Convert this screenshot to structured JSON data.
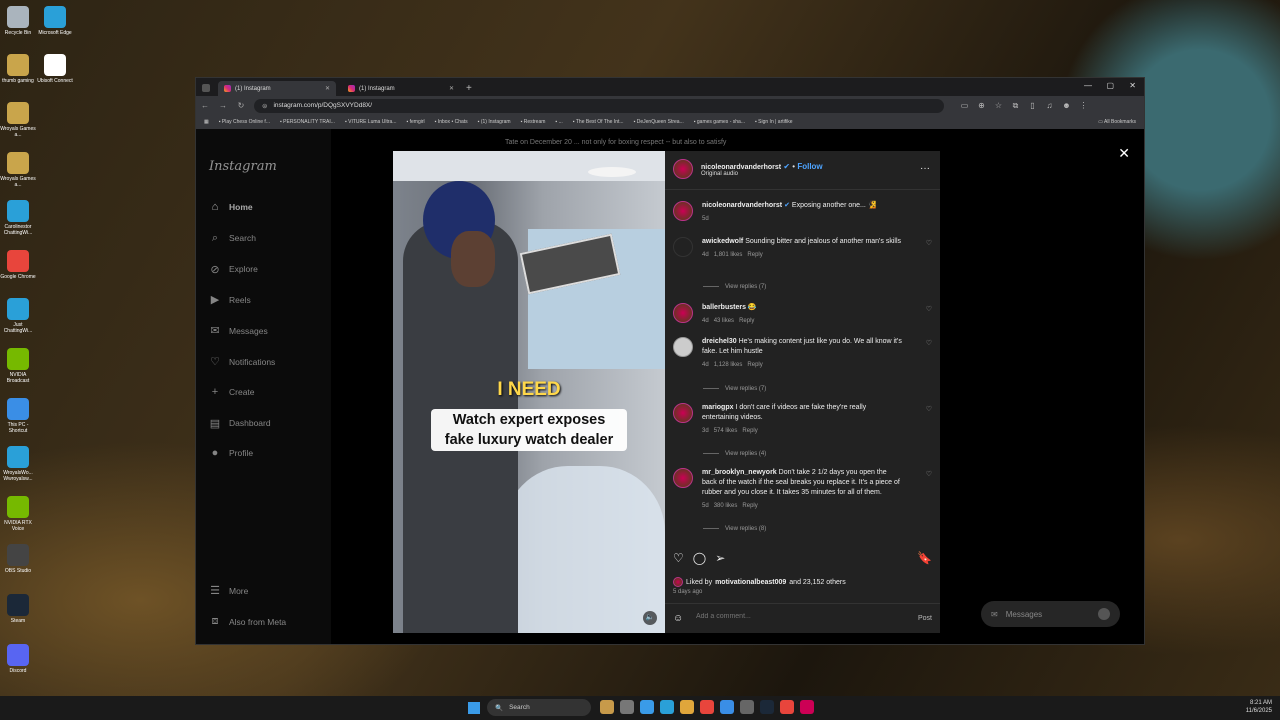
{
  "desktop": {
    "icons": [
      {
        "label": "Recycle Bin",
        "icon": "recycle-bin-icon",
        "color": "#aab4bd"
      },
      {
        "label": "Microsoft Edge",
        "icon": "edge-icon",
        "color": "#2aa0d8"
      },
      {
        "label": "thumb gaming",
        "icon": "folder-icon",
        "color": "#c9a54b"
      },
      {
        "label": "Ubisoft Connect",
        "icon": "ubisoft-icon",
        "color": "#ffffff"
      },
      {
        "label": "Wroyals Games a...",
        "icon": "folder-icon",
        "color": "#c9a54b"
      },
      {
        "label": "Wroyals Games a...",
        "icon": "folder-icon",
        "color": "#c9a54b"
      },
      {
        "label": "Carolinestor ChattingWi...",
        "icon": "edge-icon",
        "color": "#2aa0d8"
      },
      {
        "label": "Google Chrome",
        "icon": "chrome-icon",
        "color": "#e8453c"
      },
      {
        "label": "Just ChattingWi...",
        "icon": "edge-icon",
        "color": "#2aa0d8"
      },
      {
        "label": "NVIDIA Broadcast",
        "icon": "nvidia-icon",
        "color": "#76b900"
      },
      {
        "label": "This PC - Shortcut",
        "icon": "pc-icon",
        "color": "#3a8ee6"
      },
      {
        "label": "WroyalsWo... Wwroyalsw...",
        "icon": "edge-icon",
        "color": "#2aa0d8"
      },
      {
        "label": "NVIDIA RTX Voice",
        "icon": "nvidia-icon",
        "color": "#76b900"
      },
      {
        "label": "OBS Studio",
        "icon": "obs-icon",
        "color": "#444444"
      },
      {
        "label": "Steam",
        "icon": "steam-icon",
        "color": "#1b2838"
      },
      {
        "label": "Discord",
        "icon": "discord-icon",
        "color": "#5865f2"
      }
    ]
  },
  "browser": {
    "tabs": [
      {
        "label": "(1) Instagram"
      },
      {
        "label": "(1) Instagram"
      }
    ],
    "url": "instagram.com/p/DQgSXVYDd8X/",
    "bookmarks": [
      "Play Chess Online f...",
      "PERSONALITY TRAI...",
      "VITURE Luma Ultra...",
      "femgirl",
      "Inbox • Chats",
      "(1) Instagram",
      "Restream",
      "...",
      "The Best Of The Int...",
      "DeJenQueen Strea...",
      "games games - sha...",
      "Sign In | artifike"
    ],
    "all_bookmarks": "All Bookmarks"
  },
  "instagram": {
    "logo": "Instagram",
    "nav": [
      {
        "label": "Home",
        "icon": "home-icon"
      },
      {
        "label": "Search",
        "icon": "search-icon"
      },
      {
        "label": "Explore",
        "icon": "compass-icon"
      },
      {
        "label": "Reels",
        "icon": "reels-icon"
      },
      {
        "label": "Messages",
        "icon": "messenger-icon"
      },
      {
        "label": "Notifications",
        "icon": "heart-icon"
      },
      {
        "label": "Create",
        "icon": "plus-icon"
      },
      {
        "label": "Dashboard",
        "icon": "dashboard-icon"
      },
      {
        "label": "Profile",
        "icon": "profile-icon"
      }
    ],
    "more": "More",
    "also_from_meta": "Also from Meta",
    "background_caption": "Tate on December 20 ... not only for boxing respect -- but also to satisfy",
    "messages_button": "Messages"
  },
  "post": {
    "video_overlay_word": "I NEED",
    "video_caption_line1": "Watch expert exposes",
    "video_caption_line2": "fake luxury watch dealer",
    "author": "nicoleonardvanderhorst",
    "follow": "Follow",
    "audio": "Original audio",
    "caption_text": "Exposing another one... 🧏",
    "caption_time": "5d",
    "comments": [
      {
        "user": "awickedwolf",
        "text": "Sounding bitter and jealous of another man's skills",
        "time": "4d",
        "likes": "1,801 likes",
        "reply": "Reply",
        "view_replies": "View replies (7)"
      },
      {
        "user": "ballerbusters",
        "text": "😂",
        "time": "4d",
        "likes": "43 likes",
        "reply": "Reply",
        "view_replies": ""
      },
      {
        "user": "dreichel30",
        "text": "He's making content just like you do. We all know it's fake. Let him hustle",
        "time": "4d",
        "likes": "1,128 likes",
        "reply": "Reply",
        "view_replies": "View replies (7)"
      },
      {
        "user": "mariogpx",
        "text": "I don't care if videos are fake they're really entertaining videos.",
        "time": "3d",
        "likes": "574 likes",
        "reply": "Reply",
        "view_replies": "View replies (4)"
      },
      {
        "user": "mr_brooklyn_newyork",
        "text": "Don't take 2 1/2 days you open the back of the watch if the seal breaks you replace it. It's a piece of rubber and you close it. It takes 35 minutes for all of them.",
        "time": "5d",
        "likes": "380 likes",
        "reply": "Reply",
        "view_replies": "View replies (8)"
      }
    ],
    "liked_by_prefix": "Liked by",
    "liked_by_user": "motivationalbeast009",
    "liked_by_suffix": "and 23,152 others",
    "posted_ago": "5 days ago",
    "comment_placeholder": "Add a comment...",
    "post_button": "Post"
  },
  "taskbar": {
    "search": "Search",
    "time": "8:21 AM",
    "date": "11/6/2025"
  }
}
